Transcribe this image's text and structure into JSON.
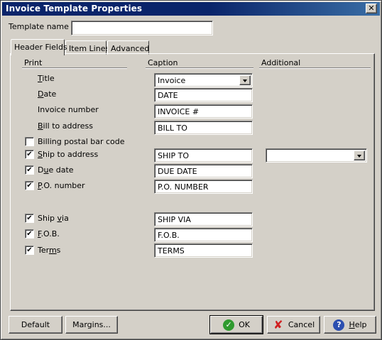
{
  "window": {
    "title": "Invoice Template Properties",
    "close_symbol": "✕"
  },
  "template_name": {
    "label": "Template name",
    "value": ""
  },
  "tabs": [
    {
      "label": "Header Fields",
      "active": true
    },
    {
      "label": "Item Lines",
      "active": false
    },
    {
      "label": "Advanced",
      "active": false
    }
  ],
  "columns": {
    "print": "Print",
    "caption": "Caption",
    "additional": "Additional"
  },
  "fields": [
    {
      "label": "Title",
      "has_checkbox": false,
      "checked": null,
      "caption": "Invoice",
      "caption_is_dropdown": true
    },
    {
      "label": "Date",
      "has_checkbox": false,
      "checked": null,
      "caption": "DATE"
    },
    {
      "label": "Invoice number",
      "has_checkbox": false,
      "checked": null,
      "caption": "INVOICE #"
    },
    {
      "label": "Bill to address",
      "has_checkbox": false,
      "checked": null,
      "caption": "BILL TO"
    },
    {
      "label": "Billing postal bar code",
      "has_checkbox": true,
      "checked": false,
      "caption": null
    },
    {
      "label": "Ship to address",
      "has_checkbox": true,
      "checked": true,
      "caption": "SHIP TO",
      "additional_dropdown_value": ""
    },
    {
      "label": "Due date",
      "has_checkbox": true,
      "checked": true,
      "caption": "DUE DATE"
    },
    {
      "label": "P.O. number",
      "has_checkbox": true,
      "checked": true,
      "caption": "P.O. NUMBER"
    },
    {
      "label": "Ship via",
      "has_checkbox": true,
      "checked": true,
      "caption": "SHIP VIA"
    },
    {
      "label": "F.O.B.",
      "has_checkbox": true,
      "checked": true,
      "caption": "F.O.B."
    },
    {
      "label": "Terms",
      "has_checkbox": true,
      "checked": true,
      "caption": "TERMS"
    }
  ],
  "check_glyph": "✔",
  "buttons": {
    "default": "Default",
    "margins": "Margins...",
    "ok": "OK",
    "cancel": "Cancel",
    "help": "Help"
  },
  "icons": {
    "ok": "check-circle-icon",
    "cancel": "red-x-icon",
    "help": "question-circle-icon"
  },
  "colors": {
    "titlebar": "#0a246a",
    "dialog_bg": "#d4d0c8",
    "ok_icon": "#2f9a2f",
    "cancel_icon": "#d02020",
    "help_icon": "#2c4fb0"
  }
}
